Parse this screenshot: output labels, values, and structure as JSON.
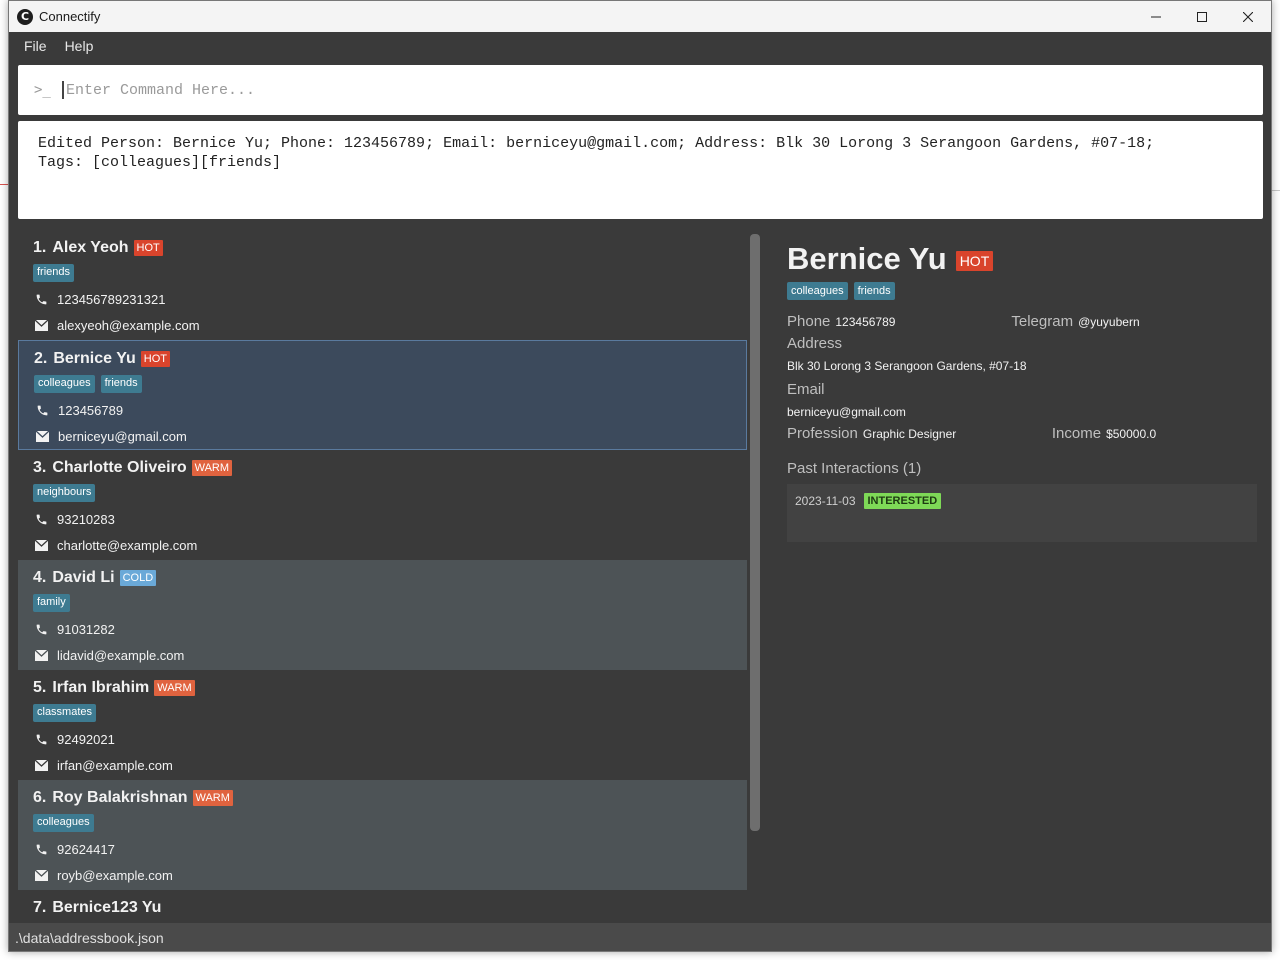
{
  "window": {
    "title": "Connectify"
  },
  "menu": {
    "file": "File",
    "help": "Help"
  },
  "command": {
    "prompt": ">_",
    "placeholder": "Enter Command Here..."
  },
  "result": {
    "text": "Edited Person: Bernice Yu; Phone: 123456789; Email: berniceyu@gmail.com; Address: Blk 30 Lorong 3 Serangoon Gardens, #07-18;\nTags: [colleagues][friends]"
  },
  "persons": [
    {
      "index": "1.",
      "name": "Alex Yeoh",
      "status": "HOT",
      "tags": [
        "friends"
      ],
      "phone": "123456789231321",
      "email": "alexyeoh@example.com"
    },
    {
      "index": "2.",
      "name": "Bernice Yu",
      "status": "HOT",
      "tags": [
        "colleagues",
        "friends"
      ],
      "phone": "123456789",
      "email": "berniceyu@gmail.com"
    },
    {
      "index": "3.",
      "name": "Charlotte Oliveiro",
      "status": "WARM",
      "tags": [
        "neighbours"
      ],
      "phone": "93210283",
      "email": "charlotte@example.com"
    },
    {
      "index": "4.",
      "name": "David Li",
      "status": "COLD",
      "tags": [
        "family"
      ],
      "phone": "91031282",
      "email": "lidavid@example.com"
    },
    {
      "index": "5.",
      "name": "Irfan Ibrahim",
      "status": "WARM",
      "tags": [
        "classmates"
      ],
      "phone": "92492021",
      "email": "irfan@example.com"
    },
    {
      "index": "6.",
      "name": "Roy Balakrishnan",
      "status": "WARM",
      "tags": [
        "colleagues"
      ],
      "phone": "92624417",
      "email": "royb@example.com"
    },
    {
      "index": "7.",
      "name": "Bernice123 Yu"
    }
  ],
  "detail": {
    "name": "Bernice Yu",
    "status": "HOT",
    "tags": [
      "colleagues",
      "friends"
    ],
    "phone_label": "Phone",
    "phone": "123456789",
    "telegram_label": "Telegram",
    "telegram": "@yuyubern",
    "address_label": "Address",
    "address": "Blk 30 Lorong 3 Serangoon Gardens, #07-18",
    "email_label": "Email",
    "email": "berniceyu@gmail.com",
    "profession_label": "Profession",
    "profession": "Graphic Designer",
    "income_label": "Income",
    "income": "$50000.0",
    "past_title": "Past Interactions (1)",
    "interactions": [
      {
        "date": "2023-11-03",
        "outcome": "INTERESTED"
      }
    ]
  },
  "statusbar": {
    "path": ".\\data\\addressbook.json"
  },
  "colors": {
    "hot": "#d9442c",
    "warm": "#e0633f",
    "cold": "#6aa9d8",
    "tag": "#3e7b91",
    "interested": "#7ed957"
  },
  "icons": {
    "phone": "phone-icon",
    "email": "envelope-icon",
    "app": "app-logo-icon"
  }
}
